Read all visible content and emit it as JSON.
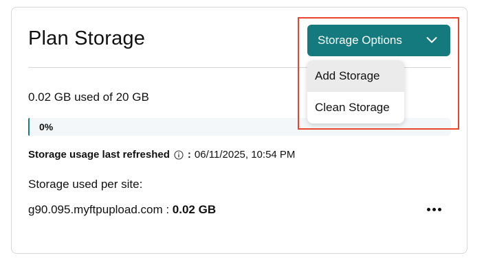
{
  "card": {
    "title": "Plan Storage",
    "usage_text": "0.02 GB used of 20 GB",
    "progress": {
      "percent": 0,
      "label": "0%"
    },
    "refresh": {
      "label": "Storage usage last refreshed",
      "colon": ":",
      "timestamp": "06/11/2025, 10:54 PM"
    },
    "per_site_label": "Storage used per site:",
    "sites": [
      {
        "domain": "g90.095.myftpupload.com",
        "separator": " : ",
        "usage": "0.02 GB"
      }
    ]
  },
  "options": {
    "button_label": "Storage Options",
    "menu_items": [
      {
        "label": "Add Storage",
        "highlighted": true
      },
      {
        "label": "Clean Storage",
        "highlighted": false
      }
    ]
  },
  "colors": {
    "accent": "#157a7d",
    "highlight_border": "#e8432e",
    "progress_track": "#f3f7fa"
  },
  "icons": {
    "info": "info-icon",
    "chevron": "chevron-down-icon",
    "more": "more-horizontal-icon"
  }
}
